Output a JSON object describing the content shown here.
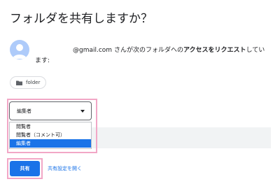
{
  "dialog": {
    "title": "フォルダを共有しますか？",
    "message": {
      "email": "@gmail.com",
      "prefix": " さんが次のフォルダへの",
      "emphasis": "アクセスをリクエスト",
      "suffix": "してい",
      "line2": "ます:"
    },
    "folder_chip": {
      "icon": "folder-icon",
      "label": "folder"
    },
    "role_select": {
      "selected": "編集者",
      "options": [
        "閲覧者",
        "閲覧者（コメント可）",
        "編集者"
      ]
    },
    "share_button": "共有",
    "settings_link": "共有設定を開く"
  },
  "colors": {
    "primary": "#1a73e8",
    "highlight": "#f2a7c6",
    "avatar": "#aecbfa"
  }
}
